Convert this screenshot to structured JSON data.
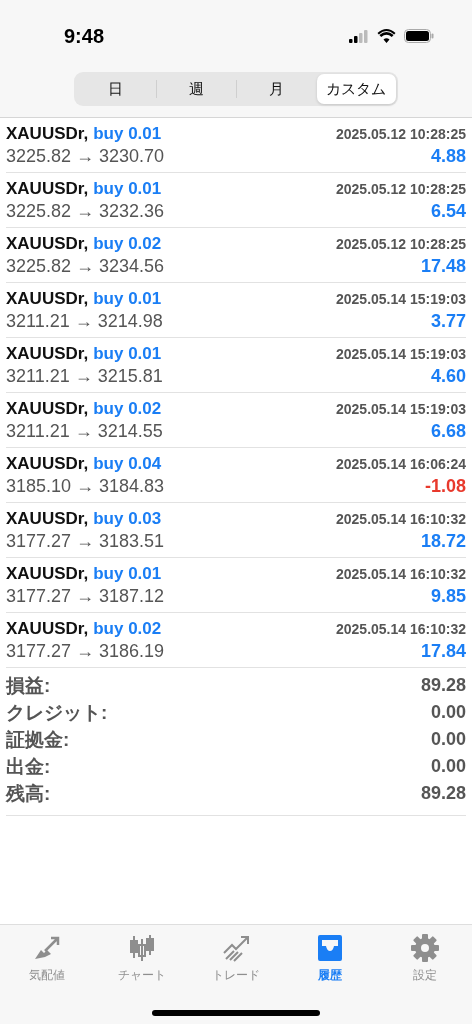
{
  "status_bar": {
    "time": "9:48"
  },
  "period_tabs": [
    {
      "label": "日",
      "selected": false
    },
    {
      "label": "週",
      "selected": false
    },
    {
      "label": "月",
      "selected": false
    },
    {
      "label": "カスタム",
      "selected": true
    }
  ],
  "trades": [
    {
      "symbol": "XAUUSDr,",
      "order": "buy 0.01",
      "time": "2025.05.12 10:28:25",
      "prices": "3225.82 → 3230.70",
      "profit": "4.88",
      "color": "#1a7ef5"
    },
    {
      "symbol": "XAUUSDr,",
      "order": "buy 0.01",
      "time": "2025.05.12 10:28:25",
      "prices": "3225.82 → 3232.36",
      "profit": "6.54",
      "color": "#1a7ef5"
    },
    {
      "symbol": "XAUUSDr,",
      "order": "buy 0.02",
      "time": "2025.05.12 10:28:25",
      "prices": "3225.82 → 3234.56",
      "profit": "17.48",
      "color": "#1a7ef5"
    },
    {
      "symbol": "XAUUSDr,",
      "order": "buy 0.01",
      "time": "2025.05.14 15:19:03",
      "prices": "3211.21 → 3214.98",
      "profit": "3.77",
      "color": "#1a7ef5"
    },
    {
      "symbol": "XAUUSDr,",
      "order": "buy 0.01",
      "time": "2025.05.14 15:19:03",
      "prices": "3211.21 → 3215.81",
      "profit": "4.60",
      "color": "#1a7ef5"
    },
    {
      "symbol": "XAUUSDr,",
      "order": "buy 0.02",
      "time": "2025.05.14 15:19:03",
      "prices": "3211.21 → 3214.55",
      "profit": "6.68",
      "color": "#1a7ef5"
    },
    {
      "symbol": "XAUUSDr,",
      "order": "buy 0.04",
      "time": "2025.05.14 16:06:24",
      "prices": "3185.10 → 3184.83",
      "profit": "-1.08",
      "color": "#e8392c"
    },
    {
      "symbol": "XAUUSDr,",
      "order": "buy 0.03",
      "time": "2025.05.14 16:10:32",
      "prices": "3177.27 → 3183.51",
      "profit": "18.72",
      "color": "#1a7ef5"
    },
    {
      "symbol": "XAUUSDr,",
      "order": "buy 0.01",
      "time": "2025.05.14 16:10:32",
      "prices": "3177.27 → 3187.12",
      "profit": "9.85",
      "color": "#1a7ef5"
    },
    {
      "symbol": "XAUUSDr,",
      "order": "buy 0.02",
      "time": "2025.05.14 16:10:32",
      "prices": "3177.27 → 3186.19",
      "profit": "17.84",
      "color": "#1a7ef5"
    }
  ],
  "summary": [
    {
      "label": "損益:",
      "value": "89.28"
    },
    {
      "label": "クレジット:",
      "value": "0.00"
    },
    {
      "label": "証拠金:",
      "value": "0.00"
    },
    {
      "label": "出金:",
      "value": "0.00"
    },
    {
      "label": "残高:",
      "value": "89.28"
    }
  ],
  "tab_bar": [
    {
      "kind": "quotes",
      "label": "気配値",
      "selected": false
    },
    {
      "kind": "chart",
      "label": "チャート",
      "selected": false
    },
    {
      "kind": "trade",
      "label": "トレード",
      "selected": false
    },
    {
      "kind": "history",
      "label": "履歴",
      "selected": true
    },
    {
      "kind": "settings",
      "label": "設定",
      "selected": false
    }
  ]
}
